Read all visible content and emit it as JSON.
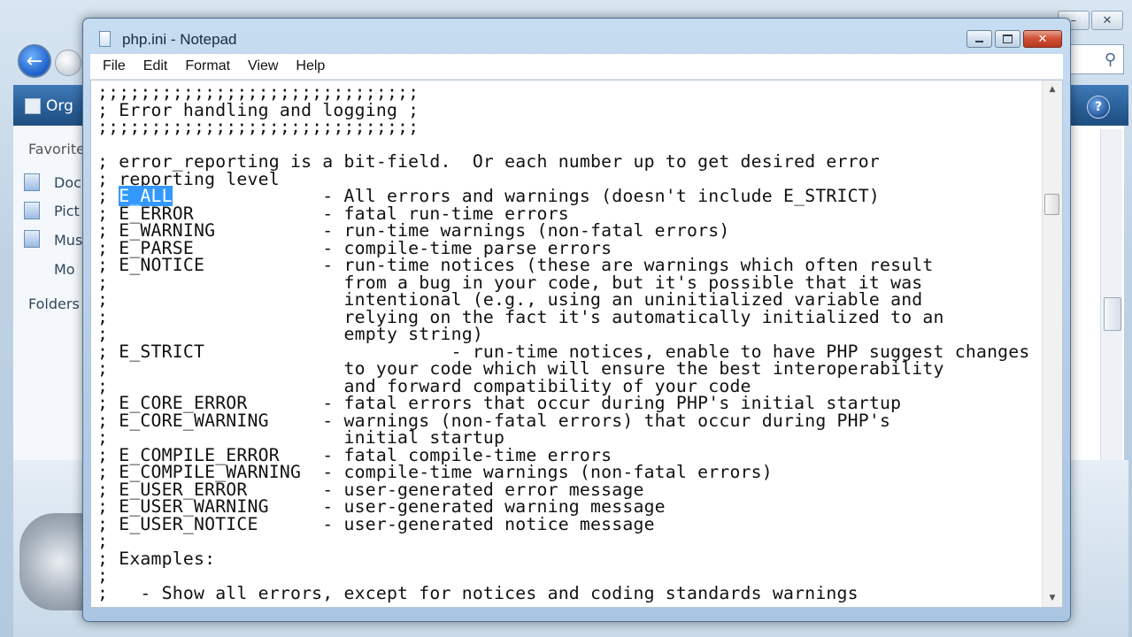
{
  "background_window": {
    "toolbar": {
      "organize_label": "Org"
    },
    "nav": {
      "favorites_label": "Favorite",
      "items": [
        "Doc",
        "Pict",
        "Mus",
        "Mo"
      ],
      "folders_label": "Folders"
    }
  },
  "notepad": {
    "title": "php.ini - Notepad",
    "menu": [
      "File",
      "Edit",
      "Format",
      "View",
      "Help"
    ],
    "content_before": ";;;;;;;;;;;;;;;;;;;;;;;;;;;;;;\n; Error handling and logging ;\n;;;;;;;;;;;;;;;;;;;;;;;;;;;;;;\n\n; error_reporting is a bit-field.  Or each number up to get desired error\n; reporting level\n; ",
    "selected_text": "E_ALL",
    "content_after": "              - All errors and warnings (doesn't include E_STRICT)\n; E_ERROR            - fatal run-time errors\n; E_WARNING          - run-time warnings (non-fatal errors)\n; E_PARSE            - compile-time parse errors\n; E_NOTICE           - run-time notices (these are warnings which often result\n;                      from a bug in your code, but it's possible that it was\n;                      intentional (e.g., using an uninitialized variable and\n;                      relying on the fact it's automatically initialized to an\n;                      empty string)\n; E_STRICT                       - run-time notices, enable to have PHP suggest changes\n;                      to your code which will ensure the best interoperability\n;                      and forward compatibility of your code\n; E_CORE_ERROR       - fatal errors that occur during PHP's initial startup\n; E_CORE_WARNING     - warnings (non-fatal errors) that occur during PHP's\n;                      initial startup\n; E_COMPILE_ERROR    - fatal compile-time errors\n; E_COMPILE_WARNING  - compile-time warnings (non-fatal errors)\n; E_USER_ERROR       - user-generated error message\n; E_USER_WARNING     - user-generated warning message\n; E_USER_NOTICE      - user-generated notice message\n;\n; Examples:\n;\n;   - Show all errors, except for notices and coding standards warnings"
  }
}
